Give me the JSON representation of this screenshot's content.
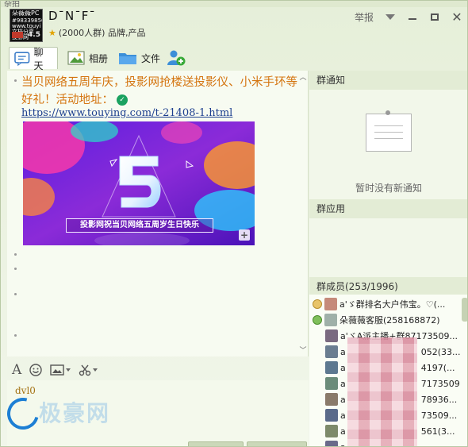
{
  "window": {
    "top_strip_text": "杂拍",
    "group_avatar_lines": [
      "朵薇薇PC",
      "#98339856",
      "www.touyi",
      "文档分享",
      "投影网"
    ],
    "group_avatar_number": "4.5",
    "group_name": "D¯N¯F¯",
    "group_meta": "(2000人群) 品牌,产品",
    "report_label": "举报"
  },
  "tabs": [
    {
      "label": "聊天",
      "icon": "chat-icon"
    },
    {
      "label": "相册",
      "icon": "photo-icon"
    },
    {
      "label": "文件",
      "icon": "folder-icon"
    },
    {
      "label": "",
      "icon": "add-member-icon"
    }
  ],
  "chat": {
    "message_text": "当贝网络五周年庆，投影网抢楼送投影仪、小米手环等好礼！活动地址：",
    "link": "https://www.touying.com/t-21408-1.html",
    "banner_caption": "投影网祝当贝网络五周岁生日快乐",
    "banner_big_number": "5"
  },
  "input": {
    "text": "dvl0",
    "watermark": "极豪网"
  },
  "right_panel": {
    "notice_header": "群通知",
    "no_notice": "暂时没有新通知",
    "apps_header": "群应用",
    "members_header": "群成员(253/1996)",
    "members": [
      {
        "name": "a'ゞ群排名大户伟宝。♡(...",
        "role": "owner"
      },
      {
        "name": "朵薇薇客服(258168872)",
        "role": "admin"
      },
      {
        "name": "a'ゞA派主播+群87173509...",
        "role": "member"
      },
      {
        "name": "a",
        "suffix": "052(33...",
        "role": "member"
      },
      {
        "name": "a",
        "suffix": "4197(...",
        "role": "member"
      },
      {
        "name": "a",
        "suffix": "7173509...",
        "role": "member"
      },
      {
        "name": "a",
        "suffix": "78936...",
        "role": "member"
      },
      {
        "name": "a",
        "suffix": "73509...",
        "role": "member"
      },
      {
        "name": "a",
        "suffix": "561(3...",
        "role": "member"
      },
      {
        "name": "a",
        "suffix": "",
        "role": "member"
      }
    ]
  },
  "colors": {
    "message_orange": "#d4740f",
    "link_blue": "#1d3f8f",
    "panel_bg": "#f2f7ea"
  }
}
